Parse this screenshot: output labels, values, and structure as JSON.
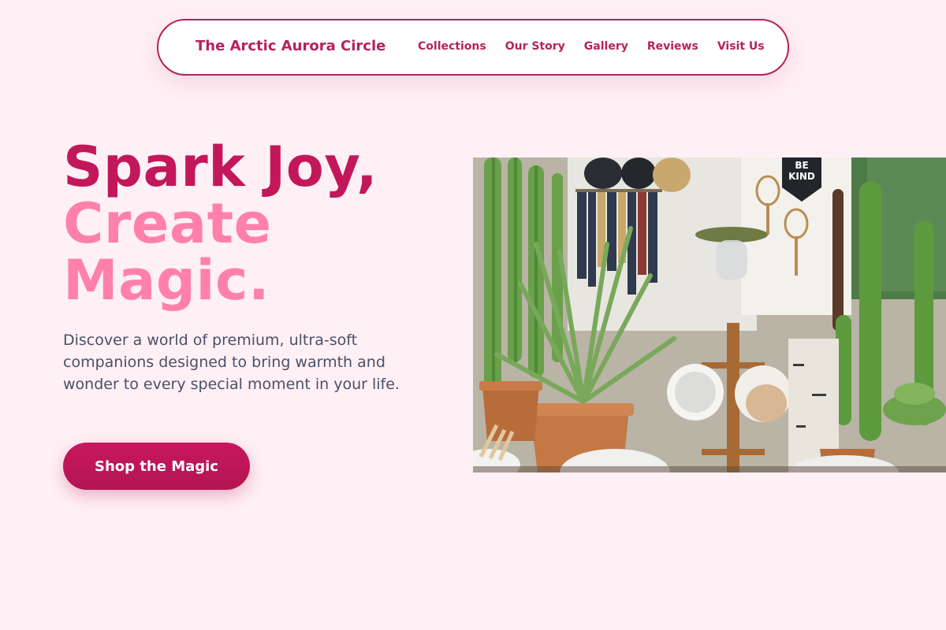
{
  "header": {
    "brand": "The Arctic Aurora Circle",
    "nav": [
      "Collections",
      "Our Story",
      "Gallery",
      "Reviews",
      "Visit Us"
    ]
  },
  "hero": {
    "headline_line1": "Spark Joy,",
    "headline_line2": "Create",
    "headline_line3": "Magic.",
    "description": "Discover a world of premium, ultra-soft companions designed to bring warmth and wonder to every special moment in your life.",
    "cta_label": "Shop the Magic",
    "image_sign_text": "BE KIND"
  },
  "colors": {
    "background": "#fff0f5",
    "brand": "#b5215e",
    "accent_pink": "#ff80ab",
    "cta": "#c2185b",
    "body_text": "#4a5068"
  }
}
